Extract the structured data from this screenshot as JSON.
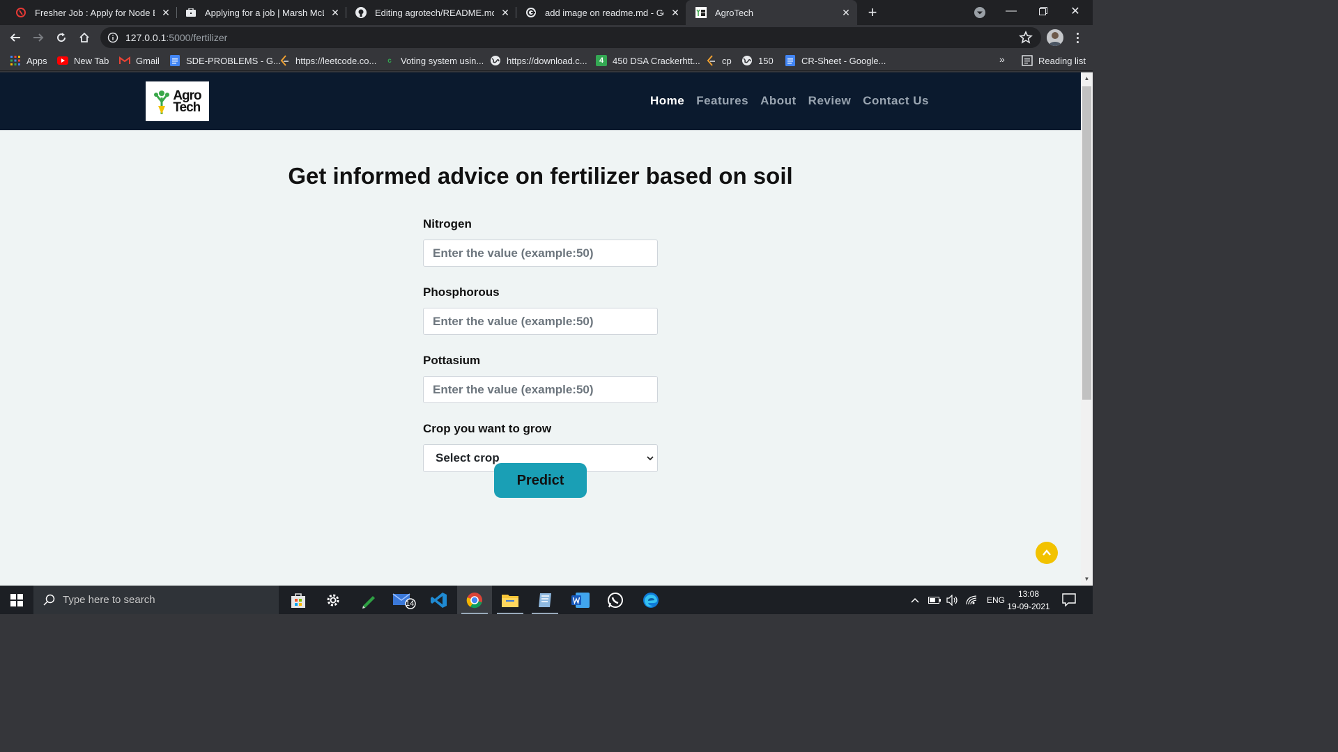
{
  "browser": {
    "tabs": [
      {
        "title": "Fresher Job : Apply for Node Eng",
        "icon": "naukri-icon",
        "active": false
      },
      {
        "title": "Applying for a job | Marsh McLen",
        "icon": "briefcase-icon",
        "active": false
      },
      {
        "title": "Editing agrotech/README.md at",
        "icon": "github-icon",
        "active": false
      },
      {
        "title": "add image on readme.md - Goog",
        "icon": "google-icon",
        "active": false
      },
      {
        "title": "AgroTech",
        "icon": "agrotech-favicon",
        "active": true
      }
    ],
    "url_host": "127.0.0.1",
    "url_path": ":5000/fertilizer",
    "bookmarks": [
      {
        "label": "Apps",
        "icon": "apps-grid-icon"
      },
      {
        "label": "New Tab",
        "icon": "youtube-icon"
      },
      {
        "label": "Gmail",
        "icon": "gmail-icon"
      },
      {
        "label": "SDE-PROBLEMS - G...",
        "icon": "docs-icon"
      },
      {
        "label": "https://leetcode.co...",
        "icon": "leetcode-icon"
      },
      {
        "label": "Voting system usin...",
        "icon": "c-icon"
      },
      {
        "label": "https://download.c...",
        "icon": "globe-icon"
      },
      {
        "label": "450 DSA Crackerhtt...",
        "icon": "sheets-icon"
      },
      {
        "label": "cp",
        "icon": "leetcode-icon"
      },
      {
        "label": "150",
        "icon": "globe-icon"
      },
      {
        "label": "CR-Sheet - Google...",
        "icon": "docs-icon"
      }
    ],
    "bookmarks_more": "»",
    "reading_list": "Reading list"
  },
  "site": {
    "logo_line1": "Agro",
    "logo_line2": "Tech",
    "nav": [
      {
        "label": "Home",
        "active": true
      },
      {
        "label": "Features",
        "active": false
      },
      {
        "label": "About",
        "active": false
      },
      {
        "label": "Review",
        "active": false
      },
      {
        "label": "Contact Us",
        "active": false
      }
    ],
    "title": "Get informed advice on fertilizer based on soil",
    "fields": [
      {
        "label": "Nitrogen",
        "placeholder": "Enter the value (example:50)"
      },
      {
        "label": "Phosphorous",
        "placeholder": "Enter the value (example:50)"
      },
      {
        "label": "Pottasium",
        "placeholder": "Enter the value (example:50)"
      }
    ],
    "crop_label": "Crop you want to grow",
    "crop_selected": "Select crop",
    "predict_label": "Predict"
  },
  "taskbar": {
    "search_placeholder": "Type here to search",
    "mail_badge": "14",
    "language": "ENG",
    "time": "13:08",
    "date": "19-09-2021"
  },
  "colors": {
    "nav_bg": "#0b1a2e",
    "page_bg": "#eff4f4",
    "predict_bg": "#1a9fb5",
    "to_top_bg": "#f2c200"
  }
}
